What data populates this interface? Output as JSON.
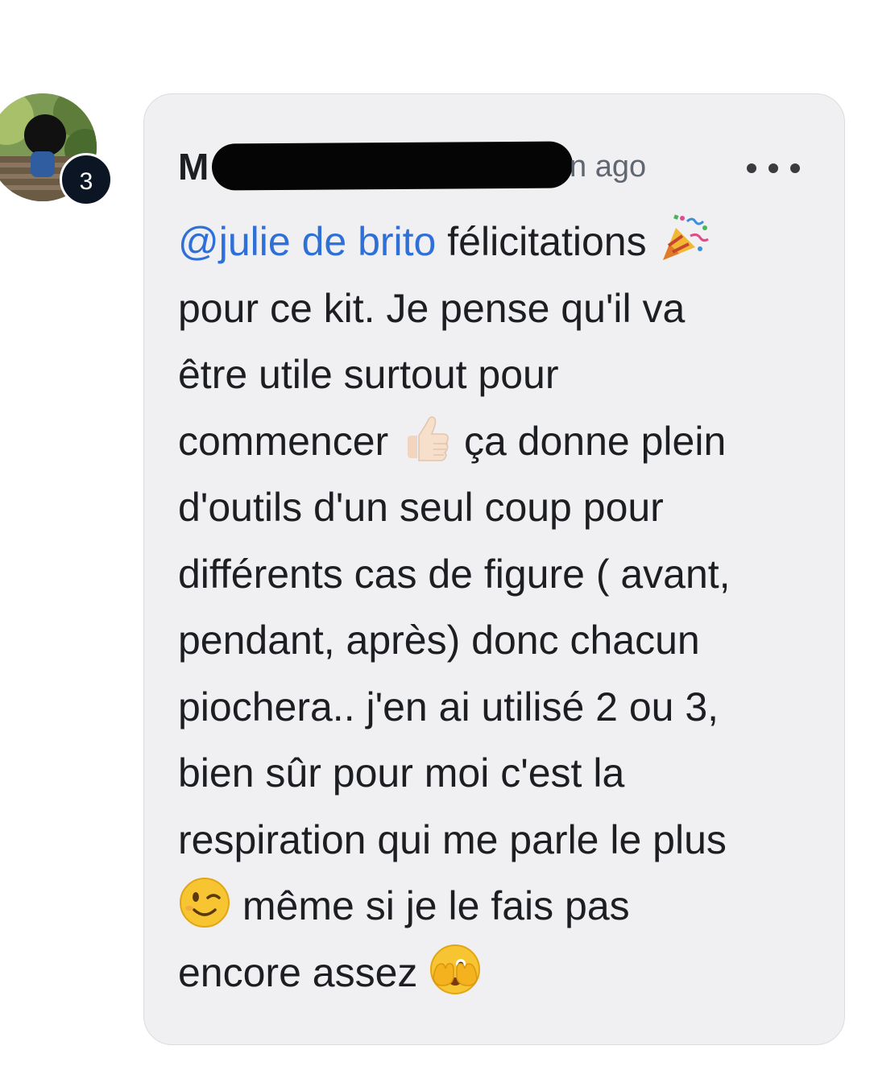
{
  "comment": {
    "author_initial": "M",
    "time_suffix": "n ago",
    "avatar_badge": "3",
    "mention": "@julie de brito",
    "lines": [
      " félicitations",
      "pour ce kit. Je pense qu'il va",
      "être utile surtout pour",
      "commencer",
      " ça donne plein",
      "d'outils d'un seul coup pour",
      "différents cas de figure ( avant,",
      "pendant, après) donc chacun",
      "piochera.. j'en ai utilisé 2 ou 3,",
      "bien sûr pour moi c'est la",
      "respiration qui me parle le plus",
      " même si je le fais pas",
      "encore assez "
    ],
    "emojis": [
      "party-popper-icon",
      "thumbs-up-icon",
      "winking-face-icon",
      "face-with-peeking-eye-icon"
    ]
  },
  "colors": {
    "mention": "#2f6fd8",
    "bubble_bg": "#f0f0f2",
    "text": "#1c1e21",
    "time": "#606770",
    "badge": "#0c1524"
  }
}
